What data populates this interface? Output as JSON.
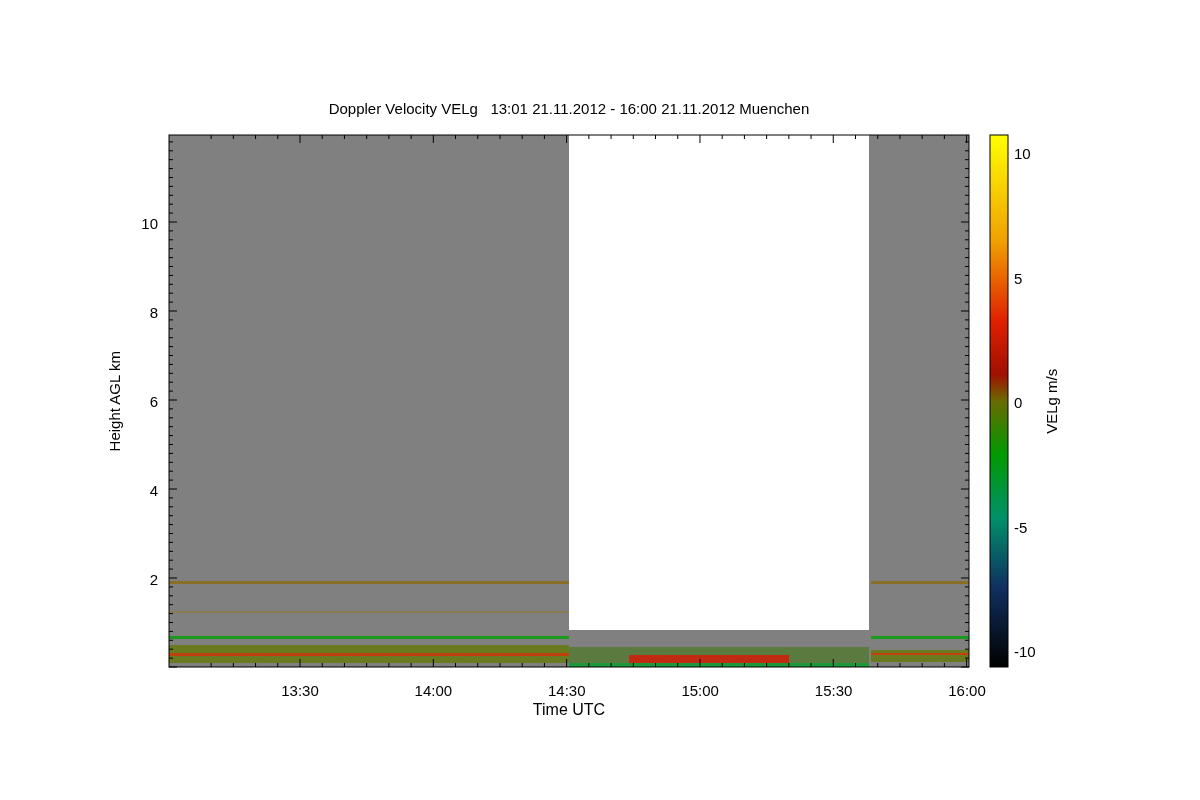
{
  "title": "Doppler Velocity VELg   13:01 21.11.2012 - 16:00 21.11.2012 Muenchen",
  "plot": {
    "ylabel": "Height AGL km",
    "xlabel": "Time UTC",
    "xticks": [
      "13:30",
      "14:00",
      "14:30",
      "15:00",
      "15:30",
      "16:00"
    ],
    "yticks": [
      "10",
      "8",
      "6",
      "4",
      "2"
    ]
  },
  "colorbar": {
    "label": "VELg m/s",
    "ticks": [
      "10",
      "5",
      "0",
      "-5",
      "-10"
    ]
  }
}
